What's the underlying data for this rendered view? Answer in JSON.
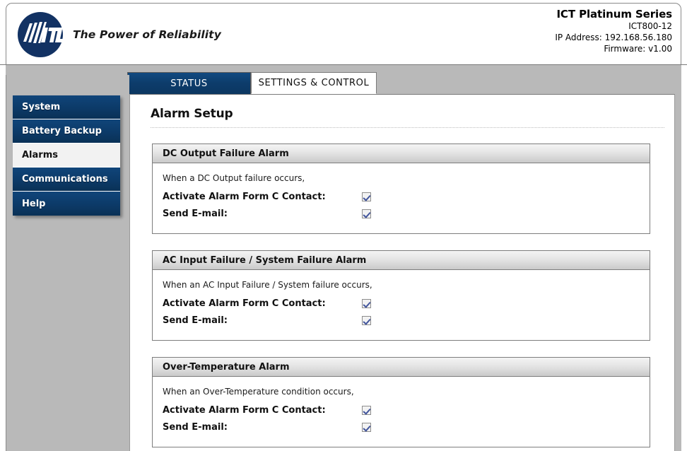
{
  "header": {
    "logo_icon": "ict-circle-logo",
    "logo_text": "ICT",
    "tagline": "The Power of Reliability",
    "device_title": "ICT Platinum Series",
    "model": "ICT800-12",
    "ip_address": "IP Address: 192.168.56.180",
    "firmware": "Firmware: v1.00"
  },
  "tabs": [
    {
      "label": "STATUS",
      "active": false
    },
    {
      "label": "SETTINGS & CONTROL",
      "active": true
    }
  ],
  "sidebar": {
    "items": [
      {
        "label": "System",
        "active": false
      },
      {
        "label": "Battery Backup",
        "active": false
      },
      {
        "label": "Alarms",
        "active": true
      },
      {
        "label": "Communications",
        "active": false
      },
      {
        "label": "Help",
        "active": false
      }
    ]
  },
  "main": {
    "page_title": "Alarm Setup",
    "alarms": [
      {
        "title": "DC Output Failure Alarm",
        "condition": "When a DC Output failure occurs,",
        "options": [
          {
            "label": "Activate Alarm Form C Contact:",
            "checked": true
          },
          {
            "label": "Send E-mail:",
            "checked": true
          }
        ]
      },
      {
        "title": "AC Input Failure / System Failure Alarm",
        "condition": "When an AC Input Failure / System failure occurs,",
        "options": [
          {
            "label": "Activate Alarm Form C Contact:",
            "checked": true
          },
          {
            "label": "Send E-mail:",
            "checked": true
          }
        ]
      },
      {
        "title": "Over-Temperature Alarm",
        "condition": "When an Over-Temperature condition occurs,",
        "options": [
          {
            "label": "Activate Alarm Form C Contact:",
            "checked": true
          },
          {
            "label": "Send E-mail:",
            "checked": true
          }
        ]
      }
    ]
  },
  "colors": {
    "brand_navy": "#0c3a68",
    "page_background": "#b9b9b9",
    "panel_border": "#7d7d7d",
    "check_blue": "#41549b"
  }
}
